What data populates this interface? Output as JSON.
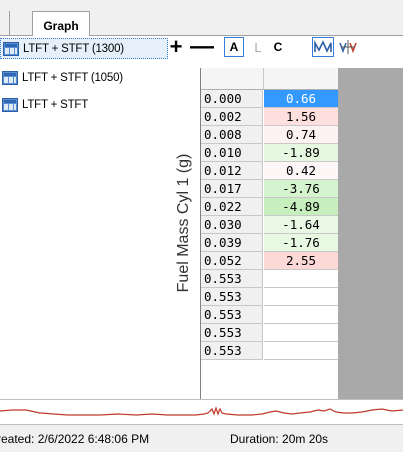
{
  "tabs": [
    {
      "label": "Graph"
    }
  ],
  "sessions": [
    {
      "label": "LTFT + STFT (1300)",
      "selected": true,
      "icon": "table-icon"
    },
    {
      "label": "LTFT + STFT (1050)",
      "selected": false,
      "icon": "table-icon"
    },
    {
      "label": "LTFT + STFT",
      "selected": false,
      "icon": "table-icon"
    }
  ],
  "toolbar": {
    "add": "+",
    "remove": "—",
    "mode_a": "A",
    "mode_l": "L",
    "mode_c": "C"
  },
  "grid": {
    "axis_label": "Fuel Mass Cyl 1  (g)",
    "rows": [
      {
        "x": "0.000",
        "y": "0.66",
        "bg": "#3399ff",
        "fg": "#ffffff"
      },
      {
        "x": "0.002",
        "y": "1.56",
        "bg": "#fde0de",
        "fg": "#000000"
      },
      {
        "x": "0.008",
        "y": "0.74",
        "bg": "#fdf2f2",
        "fg": "#000000"
      },
      {
        "x": "0.010",
        "y": "-1.89",
        "bg": "#e6f8e2",
        "fg": "#000000"
      },
      {
        "x": "0.012",
        "y": "0.42",
        "bg": "#fdf7f7",
        "fg": "#000000"
      },
      {
        "x": "0.017",
        "y": "-3.76",
        "bg": "#d6f3d0",
        "fg": "#000000"
      },
      {
        "x": "0.022",
        "y": "-4.89",
        "bg": "#c6efbd",
        "fg": "#000000"
      },
      {
        "x": "0.030",
        "y": "-1.64",
        "bg": "#e8f8e4",
        "fg": "#000000"
      },
      {
        "x": "0.039",
        "y": "-1.76",
        "bg": "#e7f8e3",
        "fg": "#000000"
      },
      {
        "x": "0.052",
        "y": "2.55",
        "bg": "#fcd8d6",
        "fg": "#000000"
      },
      {
        "x": "0.553",
        "y": "",
        "bg": "#ffffff",
        "fg": "#000000"
      },
      {
        "x": "0.553",
        "y": "",
        "bg": "#ffffff",
        "fg": "#000000"
      },
      {
        "x": "0.553",
        "y": "",
        "bg": "#ffffff",
        "fg": "#000000"
      },
      {
        "x": "0.553",
        "y": "",
        "bg": "#ffffff",
        "fg": "#000000"
      },
      {
        "x": "0.553",
        "y": "",
        "bg": "#ffffff",
        "fg": "#000000"
      }
    ]
  },
  "status": {
    "created": "reated: 2/6/2022 6:48:06 PM",
    "duration": "Duration: 20m 20s"
  },
  "colors": {
    "selection_border": "#3a7bd5",
    "waveform": "#c0392b",
    "gray_area": "#a9a9a9"
  }
}
